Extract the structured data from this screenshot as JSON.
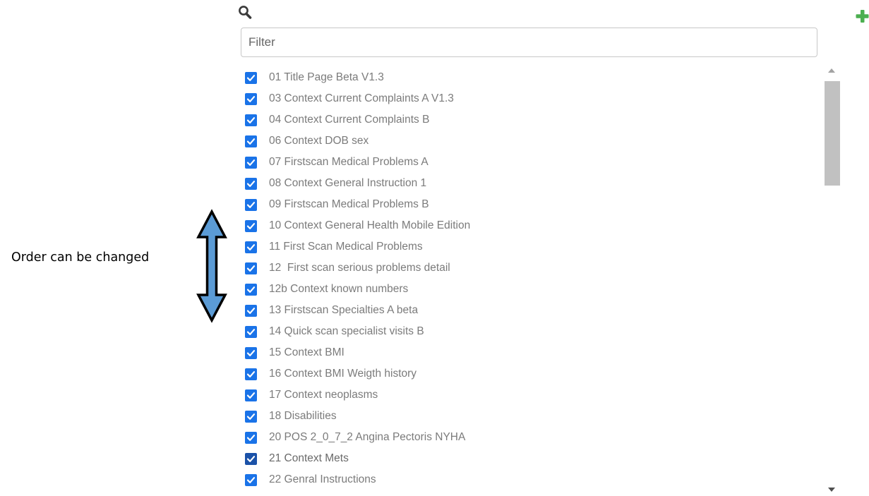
{
  "filter": {
    "placeholder": "Filter",
    "value": ""
  },
  "items": [
    {
      "label": "01 Title Page Beta V1.3",
      "checked": true
    },
    {
      "label": "03 Context Current Complaints A V1.3",
      "checked": true
    },
    {
      "label": "04 Context Current Complaints B",
      "checked": true
    },
    {
      "label": "06 Context DOB sex",
      "checked": true
    },
    {
      "label": "07 Firstscan Medical Problems A",
      "checked": true
    },
    {
      "label": "08 Context General Instruction 1",
      "checked": true
    },
    {
      "label": "09 Firstscan Medical Problems B",
      "checked": true
    },
    {
      "label": "10 Context General Health Mobile Edition",
      "checked": true
    },
    {
      "label": "11 First Scan Medical Problems",
      "checked": true
    },
    {
      "label": "12  First scan serious problems detail",
      "checked": true
    },
    {
      "label": "12b Context known numbers",
      "checked": true
    },
    {
      "label": "13 Firstscan Specialties A beta",
      "checked": true
    },
    {
      "label": "14 Quick scan specialist visits B",
      "checked": true
    },
    {
      "label": "15 Context BMI",
      "checked": true
    },
    {
      "label": "16 Context BMI Weigth history",
      "checked": true
    },
    {
      "label": "17 Context neoplasms",
      "checked": true
    },
    {
      "label": "18 Disabilities",
      "checked": true
    },
    {
      "label": "20 POS 2_0_7_2 Angina Pectoris NYHA",
      "checked": true
    },
    {
      "label": "21 Context Mets",
      "checked": true,
      "focused": true
    },
    {
      "label": "22 Genral Instructions",
      "checked": true
    }
  ],
  "annotation": {
    "text": "Order can be changed",
    "arrow_color": "#5b9bd5"
  },
  "colors": {
    "checkbox": "#1a73e8",
    "add_icon": "#4caf50",
    "text": "#7b7b7b"
  },
  "icons": {
    "search": "search-icon",
    "add": "plus-icon",
    "check": "checkmark-icon"
  }
}
